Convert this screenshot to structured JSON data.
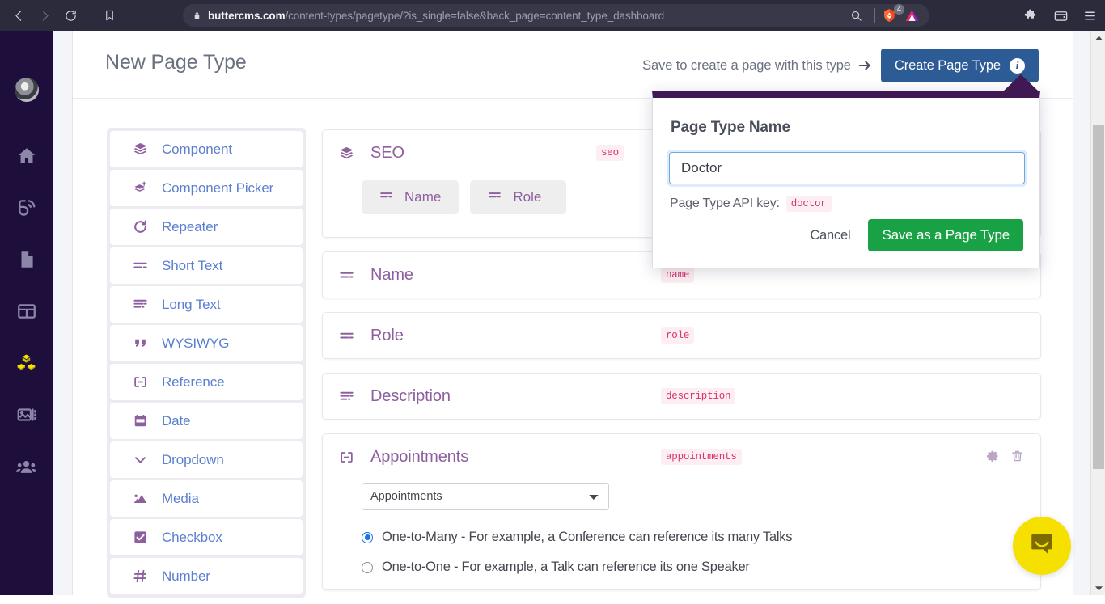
{
  "browser": {
    "url_domain": "buttercms.com",
    "url_path": "/content-types/pagetype/?is_single=false&back_page=content_type_dashboard",
    "back_icon": "back-arrow-icon",
    "forward_icon": "forward-arrow-icon",
    "reload_icon": "reload-icon",
    "bookmark_icon": "bookmark-icon",
    "lock_icon": "lock-icon",
    "zoom_icon": "zoom-search-icon",
    "brave_shield_icon": "brave-shields-icon",
    "shield_count": "4",
    "brave_rewards_icon": "brave-rewards-triangle-icon",
    "extensions_icon": "extensions-puzzle-icon",
    "wallet_icon": "brave-wallet-icon",
    "menu_icon": "hamburger-menu-icon"
  },
  "app_sidebar": {
    "avatar_label": "user-avatar",
    "items": [
      {
        "icon": "home-icon",
        "name": "home",
        "active": false
      },
      {
        "icon": "blog-rss-icon",
        "name": "blog",
        "active": false
      },
      {
        "icon": "pages-document-icon",
        "name": "pages",
        "active": false
      },
      {
        "icon": "collections-table-icon",
        "name": "collections",
        "active": false
      },
      {
        "icon": "content-types-blocks-icon",
        "name": "content-types",
        "active": true
      },
      {
        "icon": "media-image-icon",
        "name": "media",
        "active": false
      },
      {
        "icon": "team-users-icon",
        "name": "team",
        "active": false
      }
    ]
  },
  "header": {
    "title": "New Page Type",
    "save_hint": "Save to create a page with this type",
    "arrow_icon": "arrow-right-icon",
    "create_button_label": "Create Page Type",
    "info_badge": "i",
    "create_button_color": "#2d5b96"
  },
  "palette": {
    "items": [
      {
        "label": "Component",
        "icon": "layers-icon"
      },
      {
        "label": "Component Picker",
        "icon": "layers-plus-icon"
      },
      {
        "label": "Repeater",
        "icon": "refresh-loop-icon"
      },
      {
        "label": "Short Text",
        "icon": "short-text-lines-icon"
      },
      {
        "label": "Long Text",
        "icon": "long-text-lines-icon"
      },
      {
        "label": "WYSIWYG",
        "icon": "quote-marks-icon"
      },
      {
        "label": "Reference",
        "icon": "link-reference-icon"
      },
      {
        "label": "Date",
        "icon": "calendar-icon"
      },
      {
        "label": "Dropdown",
        "icon": "chevron-down-icon"
      },
      {
        "label": "Media",
        "icon": "image-mountain-icon"
      },
      {
        "label": "Checkbox",
        "icon": "checkbox-checked-icon"
      },
      {
        "label": "Number",
        "icon": "hash-number-icon"
      }
    ]
  },
  "fields": [
    {
      "title": "SEO",
      "api_key": "seo",
      "icon": "layers-icon",
      "children": [
        {
          "label": "Name",
          "icon": "short-text-lines-icon"
        },
        {
          "label": "Role",
          "icon": "short-text-lines-icon"
        }
      ]
    },
    {
      "title": "Name",
      "api_key": "name",
      "icon": "short-text-lines-icon"
    },
    {
      "title": "Role",
      "api_key": "role",
      "icon": "short-text-lines-icon"
    },
    {
      "title": "Description",
      "api_key": "description",
      "icon": "long-text-lines-icon"
    },
    {
      "title": "Appointments",
      "api_key": "appointments",
      "icon": "link-reference-icon",
      "settings_icon": "gear-icon",
      "delete_icon": "trash-icon",
      "select_value": "Appointments",
      "select_options": [
        "Appointments"
      ],
      "relations": [
        {
          "label": "One-to-Many - For example, a Conference can reference its many Talks",
          "checked": true
        },
        {
          "label": "One-to-One - For example, a Talk can reference its one Speaker",
          "checked": false
        }
      ]
    }
  ],
  "modal": {
    "title": "Page Type Name",
    "input_value": "Doctor",
    "input_placeholder": "Page Type Name",
    "api_key_label": "Page Type API key:",
    "api_key_value": "doctor",
    "cancel_label": "Cancel",
    "save_label": "Save as a Page Type",
    "accent_color": "#3f1854",
    "save_color": "#19a145"
  },
  "intercom": {
    "icon": "chat-bubble-icon",
    "color": "#f5e000"
  },
  "scrollbar": {
    "up_arrow": "scroll-up-arrow-icon",
    "down_arrow": "scroll-down-arrow-icon"
  }
}
